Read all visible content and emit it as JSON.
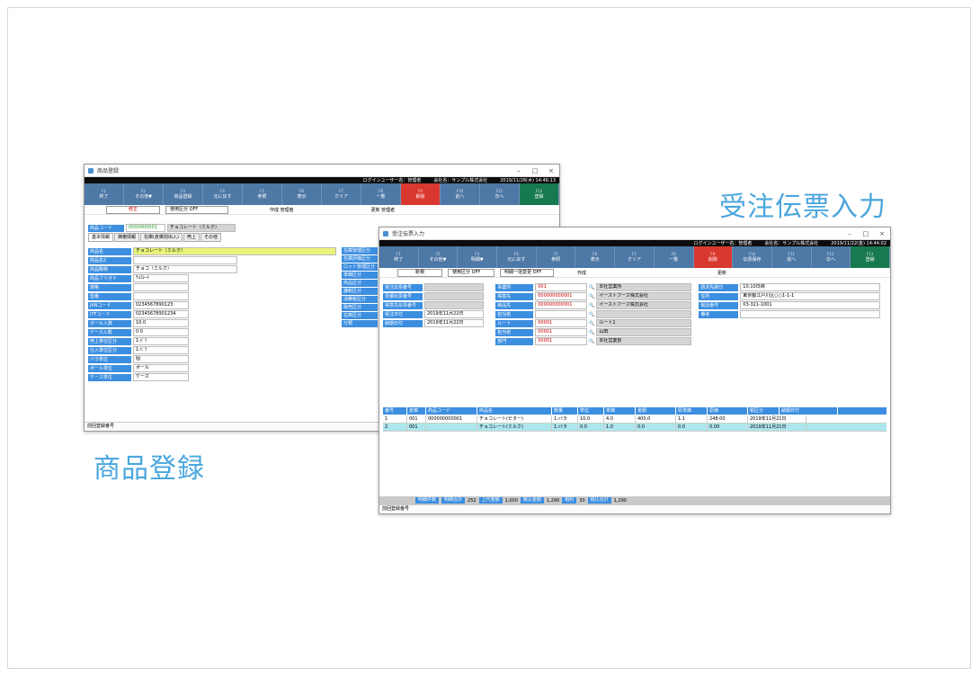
{
  "captions": {
    "order": "受注伝票入力",
    "product": "商品登録"
  },
  "product_window": {
    "title": "商品登録",
    "userbar": {
      "user": "ログインユーザー名：管理者",
      "company": "会社名：サンプル株式会社",
      "datetime": "2019/11/28(木) 14:46:13"
    },
    "toolbar": [
      "終了",
      "その他▼",
      "商品登録",
      "元に戻す",
      "参照",
      "表示",
      "クリア",
      "一覧",
      "削除",
      "前へ",
      "次へ",
      "登録"
    ],
    "info": {
      "mode": "修正",
      "flag": "使用区分 OFF",
      "creator": "作成 管理者",
      "updater": "更新 管理者"
    },
    "code_label": "商品コード",
    "code_value": "0000000001",
    "name_value": "チョコレート（ミルク）",
    "tabs": [
      "基本情報",
      "価格情報",
      "在庫(倉庫別出入)",
      "売上",
      "その他"
    ],
    "fields": [
      {
        "label": "商品名",
        "value": "チョコレート（ミルク）"
      },
      {
        "label": "商品名2",
        "value": ""
      },
      {
        "label": "商品略称",
        "value": "チョコ（ミルク）"
      },
      {
        "label": "商品フリガナ",
        "value": "ﾁｮｺﾚｰﾄ"
      },
      {
        "label": "規格",
        "value": ""
      },
      {
        "label": "型番",
        "value": ""
      },
      {
        "label": "JANコード",
        "value": "0234567890123"
      },
      {
        "label": "ITFコード",
        "value": "02345678901234"
      },
      {
        "label": "ボール入数",
        "value": "10.0"
      },
      {
        "label": "ケース入数",
        "value": "0.0"
      },
      {
        "label": "売上単位区分",
        "value": "1:ﾊﾞﾗ"
      },
      {
        "label": "仕入単位区分",
        "value": "1:ﾊﾞﾗ"
      },
      {
        "label": "バラ単位",
        "value": "個"
      },
      {
        "label": "ボール単位",
        "value": "ボール"
      },
      {
        "label": "ケース単位",
        "value": "ケース"
      }
    ],
    "right_labels": [
      "在庫管理区分",
      "在庫評価区分",
      "ロット管理区分",
      "単価区分",
      "商品区分",
      "課税区分",
      "消費税区分",
      "販売区分",
      "在庫区分",
      "分類"
    ],
    "status": "前回登録番号"
  },
  "order_window": {
    "title": "受注伝票入力",
    "userbar": {
      "user": "ログインユーザー名：管理者",
      "company": "会社名：サンプル株式会社",
      "datetime": "2019/11/22(金) 14:44:02"
    },
    "toolbar": [
      "終了",
      "その他▼",
      "明細▼",
      "元に戻す",
      "参照",
      "表示",
      "クリア",
      "一覧",
      "削除",
      "伝票保存",
      "前へ",
      "次へ",
      "登録"
    ],
    "info": {
      "mode": "新規",
      "flag1": "使用区分 OFF",
      "flag2": "明細一括変更 OFF",
      "creator": "作成",
      "updater": "更新"
    },
    "left_fields": [
      {
        "label": "受注伝票番号",
        "value": ""
      },
      {
        "label": "見積伝票番号",
        "value": ""
      },
      {
        "label": "得意先伝票番号",
        "value": ""
      },
      {
        "label": "受注日付",
        "value": "2019年11月22日"
      },
      {
        "label": "納期日付",
        "value": "2019年11月22日"
      }
    ],
    "mid_fields": [
      {
        "label": "事業所",
        "code": "001",
        "name": "本社営業所"
      },
      {
        "label": "得意先",
        "code": "000000000001",
        "name": "イーストフーズ株式会社"
      },
      {
        "label": "納品先",
        "code": "000000000001",
        "name": "イーストフーズ株式会社"
      },
      {
        "label": "担当者",
        "code": "",
        "name": ""
      },
      {
        "label": "ルート",
        "code": "00001",
        "name": "ルート1"
      },
      {
        "label": "担当者",
        "code": "00001",
        "name": "山田"
      },
      {
        "label": "部門",
        "code": "00001",
        "name": "本社営業部"
      }
    ],
    "right_fields": [
      {
        "label": "請求先締日",
        "value": "10:10日締"
      },
      {
        "label": "住所",
        "value": "東京都江戸川区○○1-1-1"
      },
      {
        "label": "電話番号",
        "value": "03-321-1001"
      },
      {
        "label": "備考",
        "value": ""
      }
    ],
    "grid_headers": [
      "番号",
      "倉庫",
      "商品コード",
      "商品名",
      "数量",
      "単位",
      "単価",
      "金額",
      "原単価",
      "原価",
      "税区分",
      "納期日付"
    ],
    "grid_rows": [
      [
        "1",
        "001",
        "000000000001",
        "チョコレート(ビター)",
        "1:バラ",
        "10.0",
        "4.0",
        "400.0",
        "1.1",
        "248.00",
        "2019年11月21日"
      ],
      [
        "2",
        "001",
        "",
        "チョコレート(ミルク)",
        "1:バラ",
        "0.0",
        "1.0",
        "0.0",
        "0.0",
        "0.00",
        "2019年11月21日"
      ]
    ],
    "footer": [
      "明細件数",
      "明細合計",
      "252",
      "上代金額",
      "1,000",
      "税込金額",
      "1,290",
      "粗利",
      "30",
      "税込合計",
      "1,290"
    ],
    "status": "前回登録番号"
  }
}
